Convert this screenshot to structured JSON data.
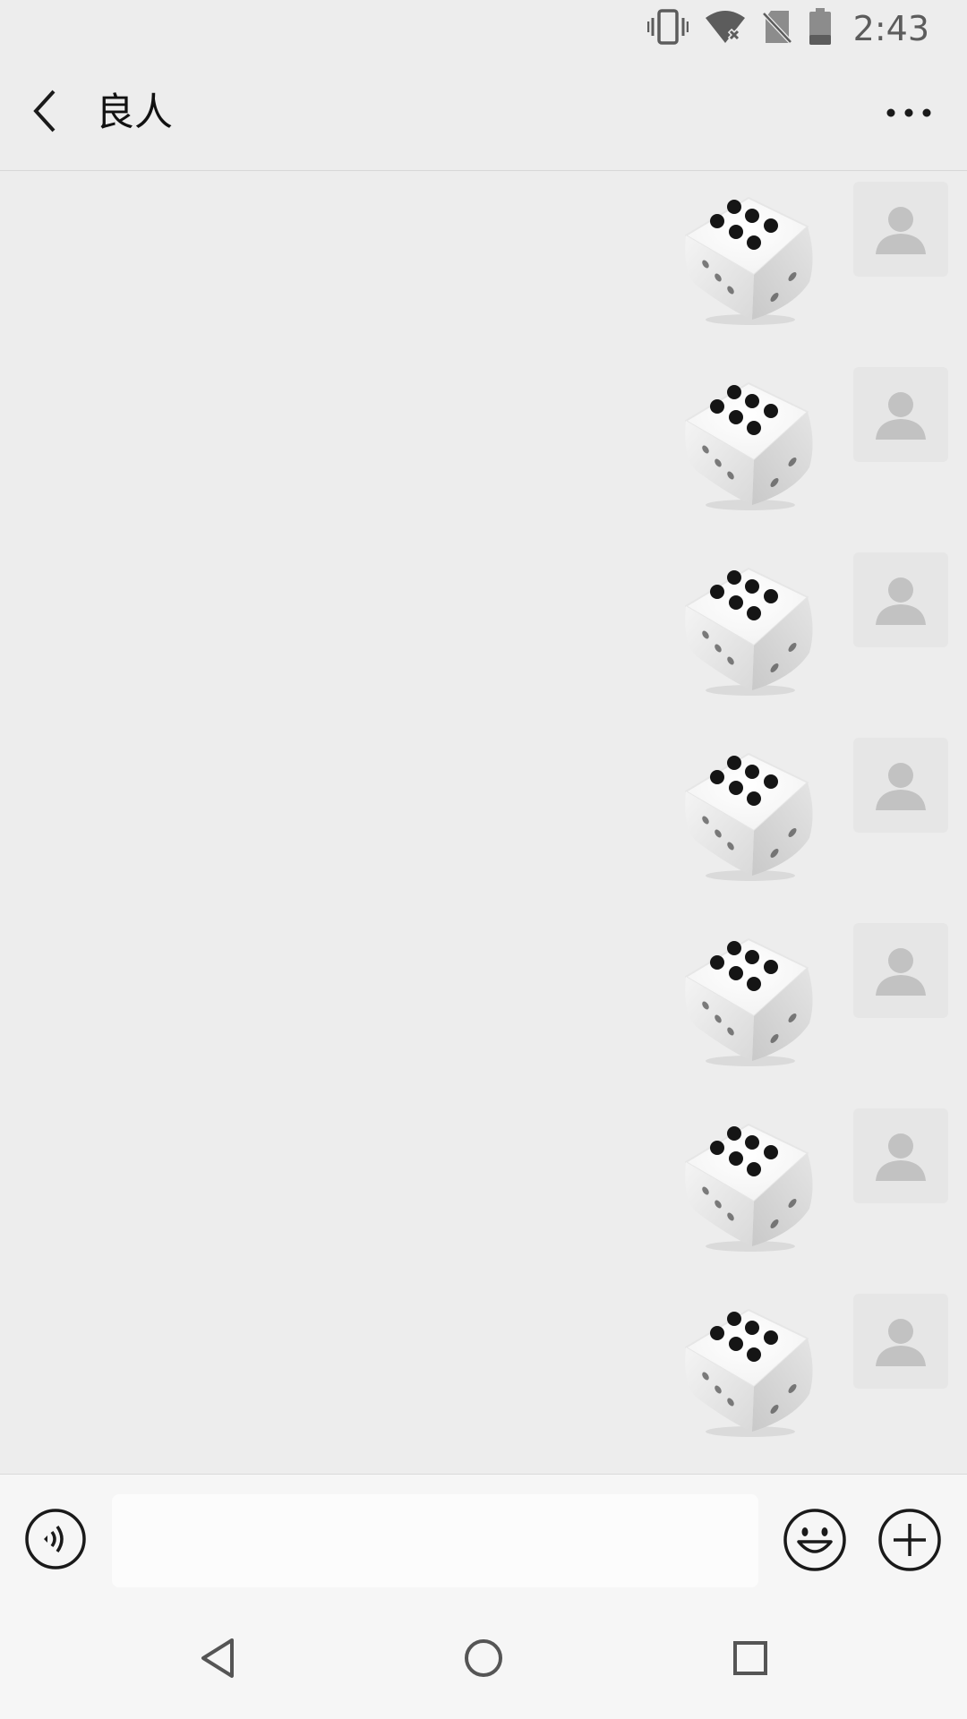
{
  "status_bar": {
    "time": "2:43",
    "icons": [
      "vibrate-icon",
      "wifi-off-icon",
      "no-sim-icon",
      "battery-icon"
    ]
  },
  "header": {
    "back_icon": "chevron-left-icon",
    "title": "良人",
    "more_icon": "more-dots-icon"
  },
  "messages": [
    {
      "sender": "me",
      "type": "dice",
      "face": 6
    },
    {
      "sender": "me",
      "type": "dice",
      "face": 6
    },
    {
      "sender": "me",
      "type": "dice",
      "face": 6
    },
    {
      "sender": "me",
      "type": "dice",
      "face": 6
    },
    {
      "sender": "me",
      "type": "dice",
      "face": 6
    },
    {
      "sender": "me",
      "type": "dice",
      "face": 6
    },
    {
      "sender": "me",
      "type": "dice",
      "face": 6
    }
  ],
  "input_bar": {
    "voice_icon": "voice-icon",
    "input_value": "",
    "input_placeholder": "",
    "emoji_icon": "emoji-icon",
    "plus_icon": "plus-icon"
  },
  "system_nav": {
    "back_icon": "nav-back-icon",
    "home_icon": "nav-home-icon",
    "recents_icon": "nav-recents-icon"
  },
  "colors": {
    "background": "#ededed",
    "bar": "#f6f6f6",
    "avatar_bg": "#e6e6e6",
    "avatar_fg": "#c2c2c2"
  }
}
